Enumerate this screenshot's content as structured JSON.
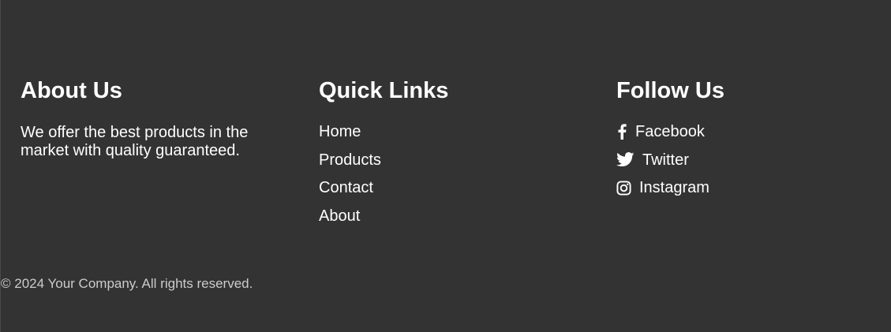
{
  "about": {
    "title": "About Us",
    "text": "We offer the best products in the market with quality guaranteed."
  },
  "quick_links": {
    "title": "Quick Links",
    "items": [
      "Home",
      "Products",
      "Contact",
      "About"
    ]
  },
  "follow": {
    "title": "Follow Us",
    "items": [
      {
        "label": "Facebook",
        "icon": "facebook-icon"
      },
      {
        "label": "Twitter",
        "icon": "twitter-icon"
      },
      {
        "label": "Instagram",
        "icon": "instagram-icon"
      }
    ]
  },
  "copyright": "© 2024 Your Company. All rights reserved.",
  "colors": {
    "background": "#333333",
    "text": "#ffffff",
    "muted": "#cccccc"
  }
}
